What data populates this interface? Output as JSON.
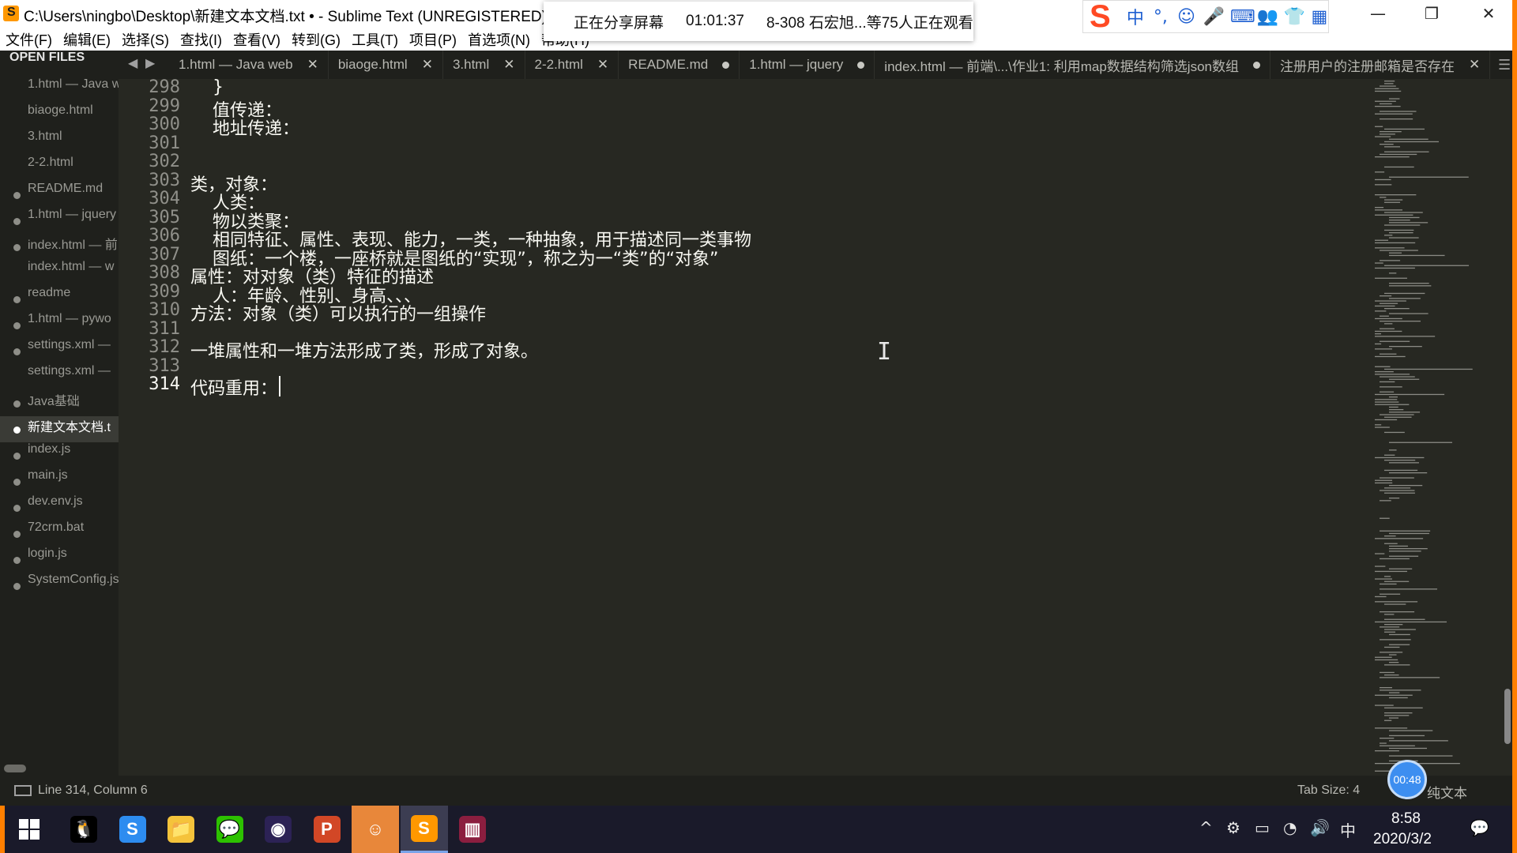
{
  "window": {
    "title": "C:\\Users\\ningbo\\Desktop\\新建文本文档.txt • - Sublime Text (UNREGISTERED)",
    "minimize": "—",
    "restore": "❐",
    "close": "✕"
  },
  "share_bar": {
    "status": "正在分享屏幕",
    "elapsed": "01:01:37",
    "viewers": "8-308 石宏旭...等75人正在观看"
  },
  "ime": {
    "logo": "S",
    "buttons": [
      "中",
      "°,",
      "☺",
      "🎤",
      "⌨",
      "👥",
      "👕",
      "▦"
    ]
  },
  "menu": [
    "文件(F)",
    "编辑(E)",
    "选择(S)",
    "查找(I)",
    "查看(V)",
    "转到(G)",
    "工具(T)",
    "项目(P)",
    "首选项(N)",
    "帮助(H)"
  ],
  "sidebar": {
    "header": "OPEN FILES",
    "files": [
      {
        "name": "1.html — Java w",
        "dot": false,
        "active": false
      },
      {
        "name": "biaoge.html",
        "dot": false,
        "active": false
      },
      {
        "name": "3.html",
        "dot": false,
        "active": false
      },
      {
        "name": "2-2.html",
        "dot": false,
        "active": false
      },
      {
        "name": "README.md",
        "dot": true,
        "active": false
      },
      {
        "name": "1.html — jquery",
        "dot": true,
        "active": false
      },
      {
        "name": "index.html — 前",
        "dot": true,
        "active": false
      },
      {
        "name": "index.html — w",
        "dot": false,
        "active": false
      },
      {
        "name": "readme",
        "dot": true,
        "active": false
      },
      {
        "name": "1.html — pywo",
        "dot": true,
        "active": false
      },
      {
        "name": "settings.xml —",
        "dot": true,
        "active": false
      },
      {
        "name": "settings.xml —",
        "dot": false,
        "active": false
      },
      {
        "name": "Java基础",
        "dot": true,
        "active": false
      },
      {
        "name": "新建文本文档.t",
        "dot": true,
        "active": true
      },
      {
        "name": "index.js",
        "dot": true,
        "active": false
      },
      {
        "name": "main.js",
        "dot": true,
        "active": false
      },
      {
        "name": "dev.env.js",
        "dot": true,
        "active": false
      },
      {
        "name": "72crm.bat",
        "dot": true,
        "active": false
      },
      {
        "name": "login.js",
        "dot": true,
        "active": false
      },
      {
        "name": "SystemConfig.js",
        "dot": true,
        "active": false
      }
    ]
  },
  "tabs": {
    "prev": "◀",
    "next": "▶",
    "menu": "☰",
    "items": [
      {
        "label": "1.html — Java web",
        "state": "close"
      },
      {
        "label": "biaoge.html",
        "state": "close"
      },
      {
        "label": "3.html",
        "state": "close"
      },
      {
        "label": "2-2.html",
        "state": "close"
      },
      {
        "label": "README.md",
        "state": "modified"
      },
      {
        "label": "1.html — jquery",
        "state": "modified"
      },
      {
        "label": "index.html — 前端\\...\\作业1: 利用map数据结构筛选json数组",
        "state": "modified"
      },
      {
        "label": "注册用户的注册邮箱是否存在",
        "state": "close"
      }
    ]
  },
  "editor": {
    "current_line": 314,
    "lines": [
      {
        "no": "298",
        "text": "    }"
      },
      {
        "no": "299",
        "text": "    值传递："
      },
      {
        "no": "300",
        "text": "    地址传递："
      },
      {
        "no": "301",
        "text": ""
      },
      {
        "no": "302",
        "text": ""
      },
      {
        "no": "303",
        "text": "类，对象："
      },
      {
        "no": "304",
        "text": "    人类："
      },
      {
        "no": "305",
        "text": "    物以类聚："
      },
      {
        "no": "306",
        "text": "    相同特征、属性、表现、能力，一类，一种抽象，用于描述同一类事物"
      },
      {
        "no": "307",
        "text": "    图纸：一个楼，一座桥就是图纸的“实现”，称之为一“类”的“对象”"
      },
      {
        "no": "308",
        "text": "属性：对对象（类）特征的描述"
      },
      {
        "no": "309",
        "text": "    人：年龄、性别、身高、、、"
      },
      {
        "no": "310",
        "text": "方法：对象（类）可以执行的一组操作"
      },
      {
        "no": "311",
        "text": ""
      },
      {
        "no": "312",
        "text": "一堆属性和一堆方法形成了类，形成了对象。"
      },
      {
        "no": "313",
        "text": ""
      },
      {
        "no": "314",
        "text": "代码重用："
      }
    ]
  },
  "status": {
    "position": "Line 314, Column 6",
    "tab_size": "Tab Size: 4",
    "syntax": "纯文本",
    "timer": "00:48"
  },
  "taskbar": {
    "start_icon": "windows-logo-icon",
    "apps": [
      {
        "name": "qq",
        "glyph": "🐧",
        "color": "#000000",
        "active": false
      },
      {
        "name": "sogou-browser",
        "glyph": "S",
        "color": "#2d8cf0",
        "active": false
      },
      {
        "name": "file-explorer",
        "glyph": "📁",
        "color": "#f5c33b",
        "active": false
      },
      {
        "name": "wechat",
        "glyph": "💬",
        "color": "#2dc100",
        "active": false
      },
      {
        "name": "eclipse",
        "glyph": "◉",
        "color": "#2c2255",
        "active": false
      },
      {
        "name": "powerpoint",
        "glyph": "P",
        "color": "#d24726",
        "active": false
      },
      {
        "name": "avatar-app",
        "glyph": "☺",
        "color": "#e8873a",
        "active": true
      },
      {
        "name": "sublime-text",
        "glyph": "S",
        "color": "#ff9800",
        "active": true
      },
      {
        "name": "winrar",
        "glyph": "▥",
        "color": "#8b1e3f",
        "active": false
      }
    ],
    "tray": [
      "^",
      "⚙",
      "▭",
      "◔",
      "🔊",
      "中"
    ],
    "time": "8:58",
    "date": "2020/3/2",
    "notification": "💬"
  },
  "colors": {
    "editor_bg": "#272822",
    "sidebar_bg": "#1f201c",
    "accent_orange": "#ff7f00",
    "text": "#f8f8f2"
  }
}
